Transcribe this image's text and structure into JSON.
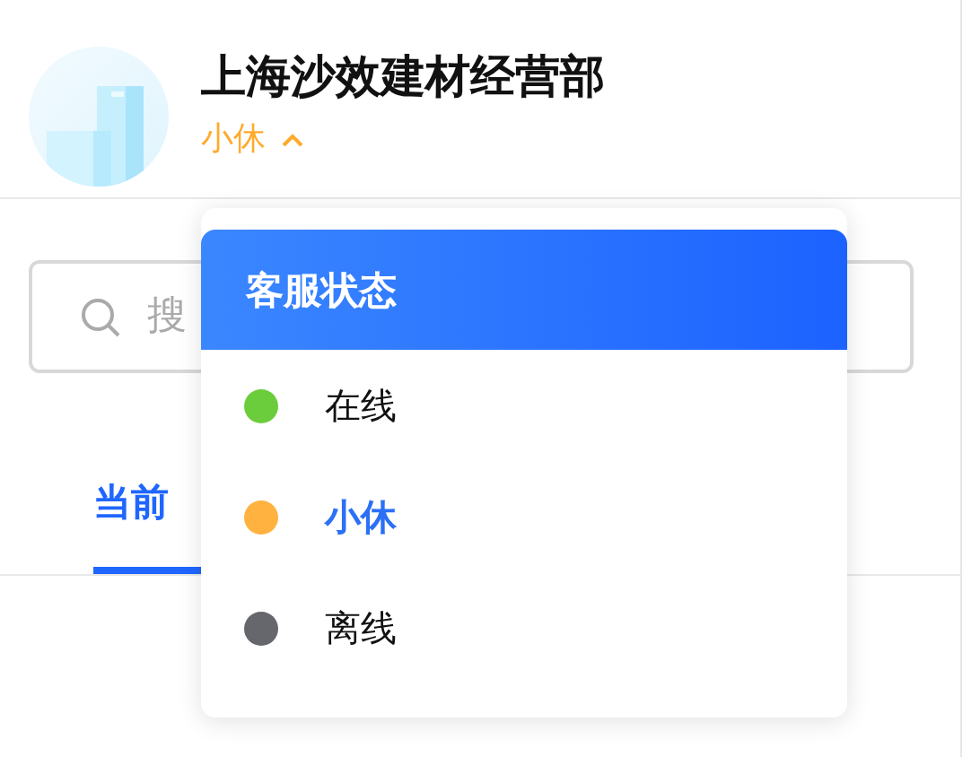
{
  "header": {
    "title": "上海沙效建材经营部",
    "status": {
      "label": "小休",
      "color": "#ffaa2b",
      "expanded": true
    }
  },
  "search": {
    "placeholder": "搜"
  },
  "tabs": [
    {
      "label": "当前",
      "selected": true
    }
  ],
  "status_menu": {
    "title": "客服状态",
    "items": [
      {
        "label": "在线",
        "color": "#6ccd3c",
        "selected": false
      },
      {
        "label": "小休",
        "color": "#ffb23f",
        "selected": true
      },
      {
        "label": "离线",
        "color": "#66676c",
        "selected": false
      }
    ]
  }
}
